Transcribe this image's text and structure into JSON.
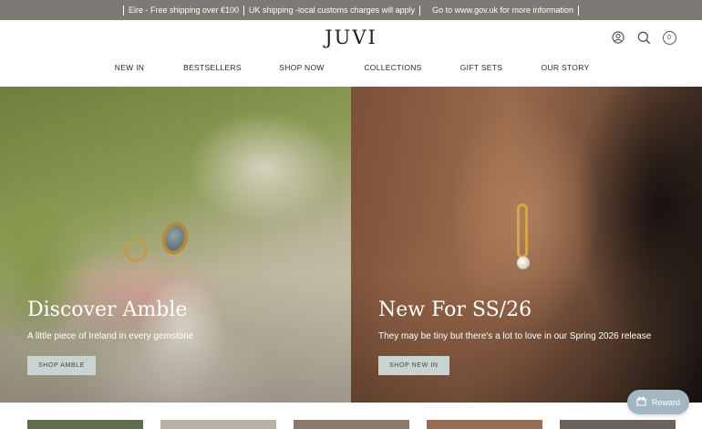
{
  "announcement": {
    "messages": [
      "Eire - Free shipping over €100",
      "UK shipping -local customs charges will apply",
      "Go to www.gov.uk for more information"
    ]
  },
  "header": {
    "logo": "JUVI",
    "cart_count": "0",
    "icons": [
      "account-icon",
      "search-icon",
      "cart-icon"
    ]
  },
  "nav": {
    "items": [
      "NEW IN",
      "BESTSELLERS",
      "SHOP NOW",
      "COLLECTIONS",
      "GIFT SETS",
      "OUR STORY"
    ]
  },
  "hero": {
    "left": {
      "title": "Discover Amble",
      "subtitle": "A little piece of Ireland in every gemstone",
      "button": "SHOP AMBLE"
    },
    "right": {
      "title": "New For SS/26",
      "subtitle": "They may be tiny but there's a lot to love in our Spring 2026 release",
      "button": "SHOP NEW IN"
    }
  },
  "reward": {
    "label": "Reward"
  },
  "colors": {
    "announcement_bg": "#7d7a75",
    "button_bg": "#c9d4d2",
    "reward_bg": "#a3b7c3"
  }
}
